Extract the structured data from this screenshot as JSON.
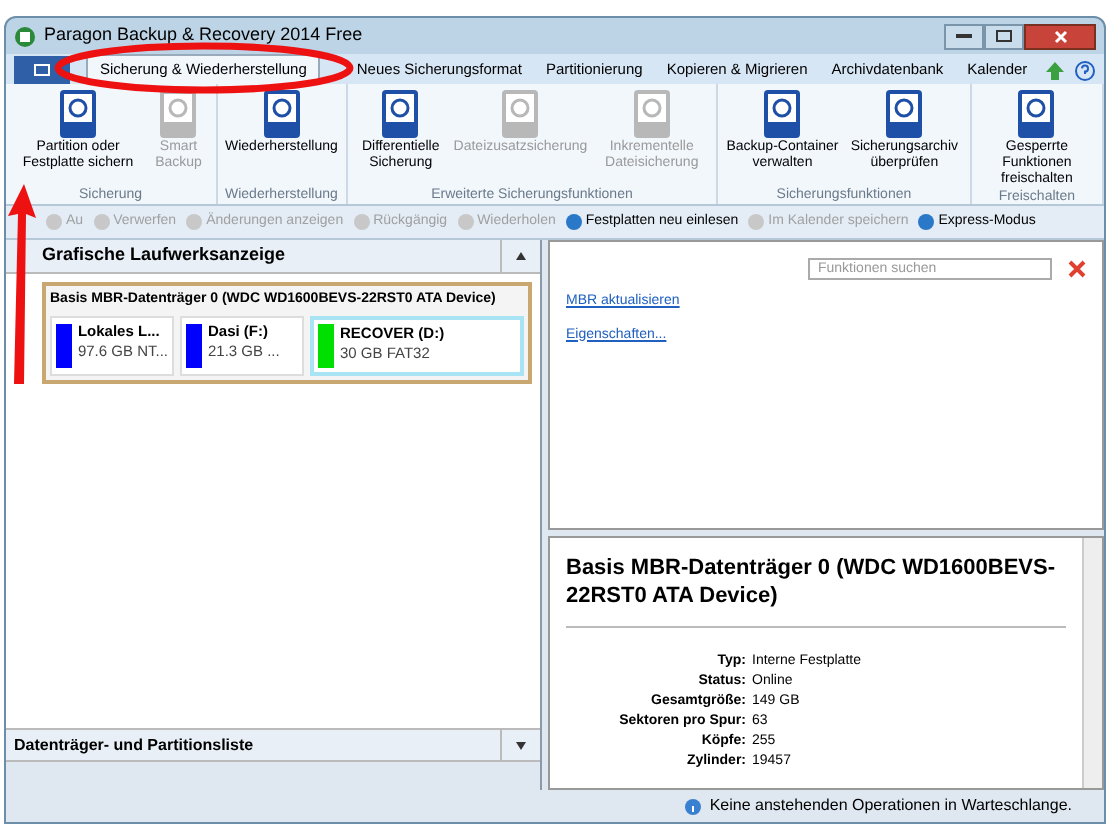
{
  "window": {
    "title": "Paragon Backup & Recovery 2014 Free"
  },
  "tabs": [
    {
      "label": "Sicherung & Wiederherstellung",
      "selected": true
    },
    {
      "label": "Neues Sicherungsformat",
      "selected": false
    },
    {
      "label": "Partitionierung",
      "selected": false
    },
    {
      "label": "Kopieren & Migrieren",
      "selected": false
    },
    {
      "label": "Archivdatenbank",
      "selected": false
    },
    {
      "label": "Kalender",
      "selected": false
    }
  ],
  "ribbon_groups": [
    {
      "label": "Sicherung",
      "buttons": [
        {
          "label": "Partition oder Festplatte sichern",
          "disabled": false
        },
        {
          "label": "Smart Backup",
          "disabled": true
        }
      ]
    },
    {
      "label": "Wiederherstellung",
      "buttons": [
        {
          "label": "Wiederherstellung",
          "disabled": false
        }
      ]
    },
    {
      "label": "Erweiterte Sicherungsfunktionen",
      "buttons": [
        {
          "label": "Differentielle Sicherung",
          "disabled": false
        },
        {
          "label": "Dateizusatzsicherung",
          "disabled": true
        },
        {
          "label": "Inkrementelle Dateisicherung",
          "disabled": true
        }
      ]
    },
    {
      "label": "Sicherungsfunktionen",
      "buttons": [
        {
          "label": "Backup-Container verwalten",
          "disabled": false
        },
        {
          "label": "Sicherungsarchiv überprüfen",
          "disabled": false
        }
      ]
    },
    {
      "label": "Freischalten",
      "buttons": [
        {
          "label": "Gesperrte Funktionen freischalten",
          "disabled": false
        }
      ]
    }
  ],
  "toolbar": [
    {
      "label": "Au",
      "disabled": true
    },
    {
      "label": "Verwerfen",
      "disabled": true
    },
    {
      "label": "Änderungen anzeigen",
      "disabled": true
    },
    {
      "label": "Rückgängig",
      "disabled": true
    },
    {
      "label": "Wiederholen",
      "disabled": true
    },
    {
      "label": "Festplatten neu einlesen",
      "disabled": false
    },
    {
      "label": "Im Kalender speichern",
      "disabled": true
    },
    {
      "label": "Express-Modus",
      "disabled": false
    }
  ],
  "drive_view": {
    "title": "Grafische Laufwerksanzeige",
    "disk": "Basis MBR-Datenträger 0 (WDC WD1600BEVS-22RST0 ATA Device)",
    "partitions": [
      {
        "name": "Lokales L...",
        "info": "97.6 GB NT...",
        "color": "#0000ff",
        "selected": false
      },
      {
        "name": "Dasi (F:)",
        "info": "21.3 GB ...",
        "color": "#0000ff",
        "selected": false
      },
      {
        "name": "RECOVER (D:)",
        "info": "30 GB FAT32",
        "color": "#00e000",
        "selected": true
      }
    ]
  },
  "disk_list": {
    "title": "Datenträger- und Partitionsliste"
  },
  "search": {
    "placeholder": "Funktionen suchen"
  },
  "links": [
    "MBR aktualisieren",
    "Eigenschaften..."
  ],
  "details": {
    "title": "Basis MBR-Datenträger 0 (WDC WD1600BEVS-22RST0 ATA Device)",
    "rows": [
      {
        "label": "Typ:",
        "value": "Interne Festplatte"
      },
      {
        "label": "Status:",
        "value": "Online"
      },
      {
        "label": "Gesamtgröße:",
        "value": "149 GB"
      },
      {
        "label": "Sektoren pro Spur:",
        "value": "63"
      },
      {
        "label": "Köpfe:",
        "value": "255"
      },
      {
        "label": "Zylinder:",
        "value": "19457"
      }
    ]
  },
  "status_bar": "Keine anstehenden Operationen in Warteschlange."
}
